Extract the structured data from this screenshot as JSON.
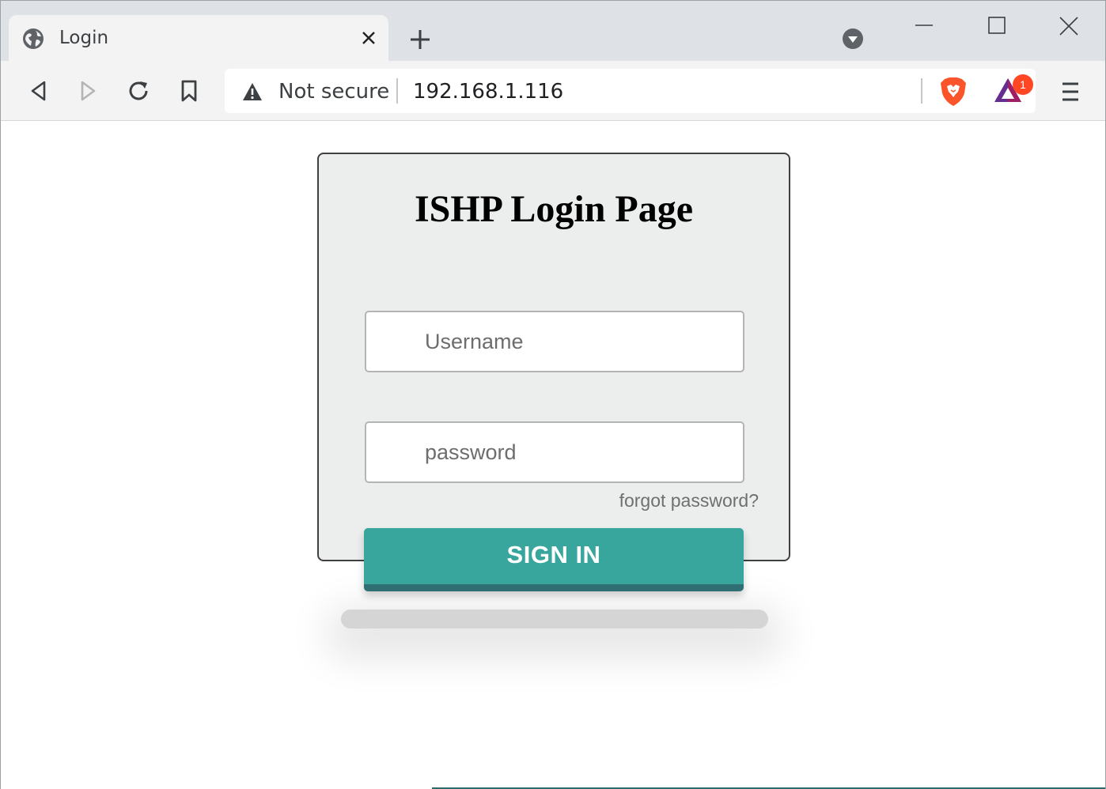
{
  "browser": {
    "tab": {
      "title": "Login"
    },
    "omnibox": {
      "security_label": "Not secure",
      "url": "192.168.1.116"
    },
    "rewards_badge": "1",
    "icons": [
      "globe-icon",
      "close-icon",
      "plus-icon",
      "tab-search-icon",
      "minimize-icon",
      "maximize-icon",
      "window-close-icon",
      "back-icon",
      "forward-icon",
      "reload-icon",
      "bookmark-icon",
      "warning-icon",
      "brave-shields-icon",
      "brave-rewards-icon",
      "hamburger-menu-icon"
    ]
  },
  "login": {
    "title": "ISHP Login Page",
    "username_placeholder": "Username",
    "password_placeholder": "password",
    "forgot_label": "forgot password?",
    "signin_label": "SIGN IN"
  },
  "colors": {
    "signin": "#38a69d",
    "signin_edge": "#2f6f74",
    "card": "#eceeee",
    "badge": "#ff4724"
  }
}
